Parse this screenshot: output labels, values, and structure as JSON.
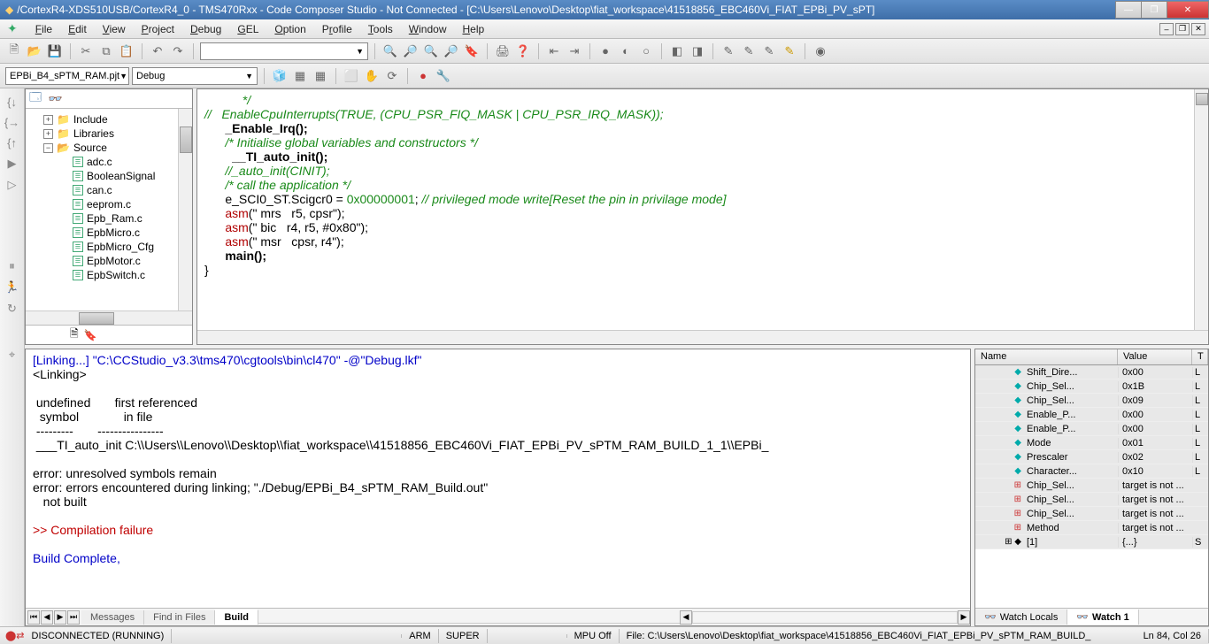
{
  "title": "/CortexR4-XDS510USB/CortexR4_0 - TMS470Rxx - Code Composer Studio - Not Connected - [C:\\Users\\Lenovo\\Desktop\\fiat_workspace\\41518856_EBC460Vi_FIAT_EPBi_PV_sPT]",
  "menu": {
    "file": "File",
    "edit": "Edit",
    "view": "View",
    "project": "Project",
    "debug": "Debug",
    "gel": "GEL",
    "option": "Option",
    "profile": "Profile",
    "tools": "Tools",
    "window": "Window",
    "help": "Help"
  },
  "proj_dd": "EPBi_B4_sPTM_RAM.pjt",
  "cfg_dd": "Debug",
  "tree": {
    "include": "Include",
    "libraries": "Libraries",
    "source": "Source",
    "files": [
      "adc.c",
      "BooleanSignal",
      "can.c",
      "eeprom.c",
      "Epb_Ram.c",
      "EpbMicro.c",
      "EpbMicro_Cfg",
      "EpbMotor.c",
      "EpbSwitch.c"
    ]
  },
  "code_lines": [
    {
      "c": "cmt",
      "t": "           */"
    },
    {
      "c": "cmt",
      "t": "//   EnableCpuInterrupts(TRUE, (CPU_PSR_FIQ_MASK | CPU_PSR_IRQ_MASK));"
    },
    {
      "c": "",
      "t": "      _Enable_Irq();",
      "bold": true
    },
    {
      "c": "cmt",
      "t": "      /* Initialise global variables and constructors */"
    },
    {
      "c": "",
      "t": "        __TI_auto_init();",
      "bold": true
    },
    {
      "c": "cmt",
      "t": "      //_auto_init(CINIT);"
    },
    {
      "c": "cmt",
      "t": "      /* call the application */"
    },
    {
      "c": "",
      "t": ""
    },
    {
      "c": "mix",
      "t": "      e_SCI0_ST.Scigcr0 = ",
      "num": "0x00000001",
      "tail": "; ",
      "cmt2": "// privileged mode write[Reset the pin in privilage mode]"
    },
    {
      "c": "",
      "t": ""
    },
    {
      "c": "asm",
      "t": "      asm(\" mrs   r5, cpsr\");"
    },
    {
      "c": "asm",
      "t": "      asm(\" bic   r4, r5, #0x80\");"
    },
    {
      "c": "asm",
      "t": "      asm(\" msr   cpsr, r4\");"
    },
    {
      "c": "",
      "t": "      main();",
      "bold": true
    },
    {
      "c": "",
      "t": ""
    },
    {
      "c": "",
      "t": "}"
    }
  ],
  "build_lines": [
    {
      "c": "blue",
      "t": "[Linking...] \"C:\\CCStudio_v3.3\\tms470\\cgtools\\bin\\cl470\" -@\"Debug.lkf\""
    },
    {
      "c": "black",
      "t": "<Linking>"
    },
    {
      "c": "black",
      "t": ""
    },
    {
      "c": "black",
      "t": " undefined       first referenced"
    },
    {
      "c": "black",
      "t": "  symbol             in file"
    },
    {
      "c": "black",
      "t": " ---------       ----------------"
    },
    {
      "c": "black",
      "t": " ___TI_auto_init C:\\\\Users\\\\Lenovo\\\\Desktop\\\\fiat_workspace\\\\41518856_EBC460Vi_FIAT_EPBi_PV_sPTM_RAM_BUILD_1_1\\\\EPBi_"
    },
    {
      "c": "black",
      "t": ""
    },
    {
      "c": "black",
      "t": "error: unresolved symbols remain"
    },
    {
      "c": "black",
      "t": "error: errors encountered during linking; \"./Debug/EPBi_B4_sPTM_RAM_Build.out\""
    },
    {
      "c": "black",
      "t": "   not built"
    },
    {
      "c": "black",
      "t": ""
    },
    {
      "c": "red",
      "t": ">> Compilation failure"
    },
    {
      "c": "black",
      "t": ""
    },
    {
      "c": "blue",
      "t": "Build Complete,"
    }
  ],
  "build_tabs": {
    "messages": "Messages",
    "find": "Find in Files",
    "build": "Build"
  },
  "watch_cols": {
    "name": "Name",
    "value": "Value",
    "t": "T"
  },
  "watch_rows": [
    {
      "ic": "d",
      "name": "Shift_Dire...",
      "val": "0x00",
      "t": "L"
    },
    {
      "ic": "d",
      "name": "Chip_Sel...",
      "val": "0x1B",
      "t": "L"
    },
    {
      "ic": "d",
      "name": "Chip_Sel...",
      "val": "0x09",
      "t": "L"
    },
    {
      "ic": "d",
      "name": "Enable_P...",
      "val": "0x00",
      "t": "L"
    },
    {
      "ic": "d",
      "name": "Enable_P...",
      "val": "0x00",
      "t": "L"
    },
    {
      "ic": "d",
      "name": "Mode",
      "val": "0x01",
      "t": "L"
    },
    {
      "ic": "d",
      "name": "Prescaler",
      "val": "0x02",
      "t": "L"
    },
    {
      "ic": "d",
      "name": "Character...",
      "val": "0x10",
      "t": "L"
    },
    {
      "ic": "s",
      "name": "Chip_Sel...",
      "val": "target is not ...",
      "t": ""
    },
    {
      "ic": "s",
      "name": "Chip_Sel...",
      "val": "target is not ...",
      "t": ""
    },
    {
      "ic": "s",
      "name": "Chip_Sel...",
      "val": "target is not ...",
      "t": ""
    },
    {
      "ic": "s",
      "name": "Method",
      "val": "target is not ...",
      "t": ""
    },
    {
      "ic": "b",
      "name": "[1]",
      "val": "{...}",
      "t": "S"
    }
  ],
  "watch_tabs": {
    "locals": "Watch Locals",
    "w1": "Watch 1"
  },
  "status": {
    "conn": "DISCONNECTED (RUNNING)",
    "cpu": "ARM",
    "mode": "SUPER",
    "mpu": "MPU Off",
    "file": "File: C:\\Users\\Lenovo\\Desktop\\fiat_workspace\\41518856_EBC460Vi_FIAT_EPBi_PV_sPTM_RAM_BUILD_",
    "pos": "Ln 84, Col 26"
  }
}
